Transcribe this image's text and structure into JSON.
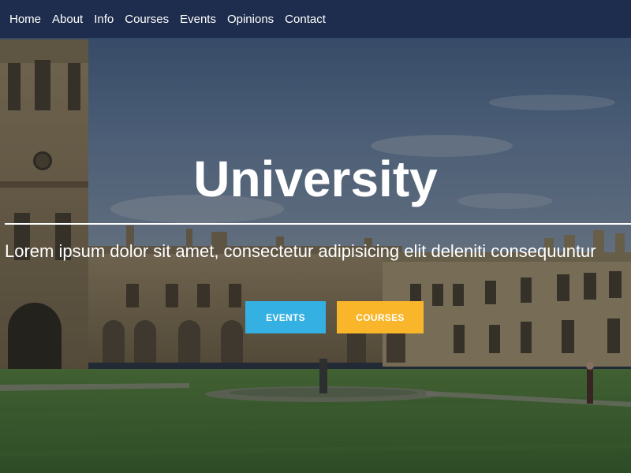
{
  "nav": {
    "items": [
      {
        "label": "Home"
      },
      {
        "label": "About"
      },
      {
        "label": "Info"
      },
      {
        "label": "Courses"
      },
      {
        "label": "Events"
      },
      {
        "label": "Opinions"
      },
      {
        "label": "Contact"
      }
    ]
  },
  "hero": {
    "title": "University",
    "subtitle": "Lorem ipsum dolor sit amet, consectetur adipisicing elit deleniti consequuntur",
    "buttons": {
      "events": "EVENTS",
      "courses": "COURSES"
    }
  },
  "colors": {
    "navbar": "#1e2d4d",
    "events_button": "#35b0e3",
    "courses_button": "#f9b62a",
    "text": "#ffffff"
  }
}
